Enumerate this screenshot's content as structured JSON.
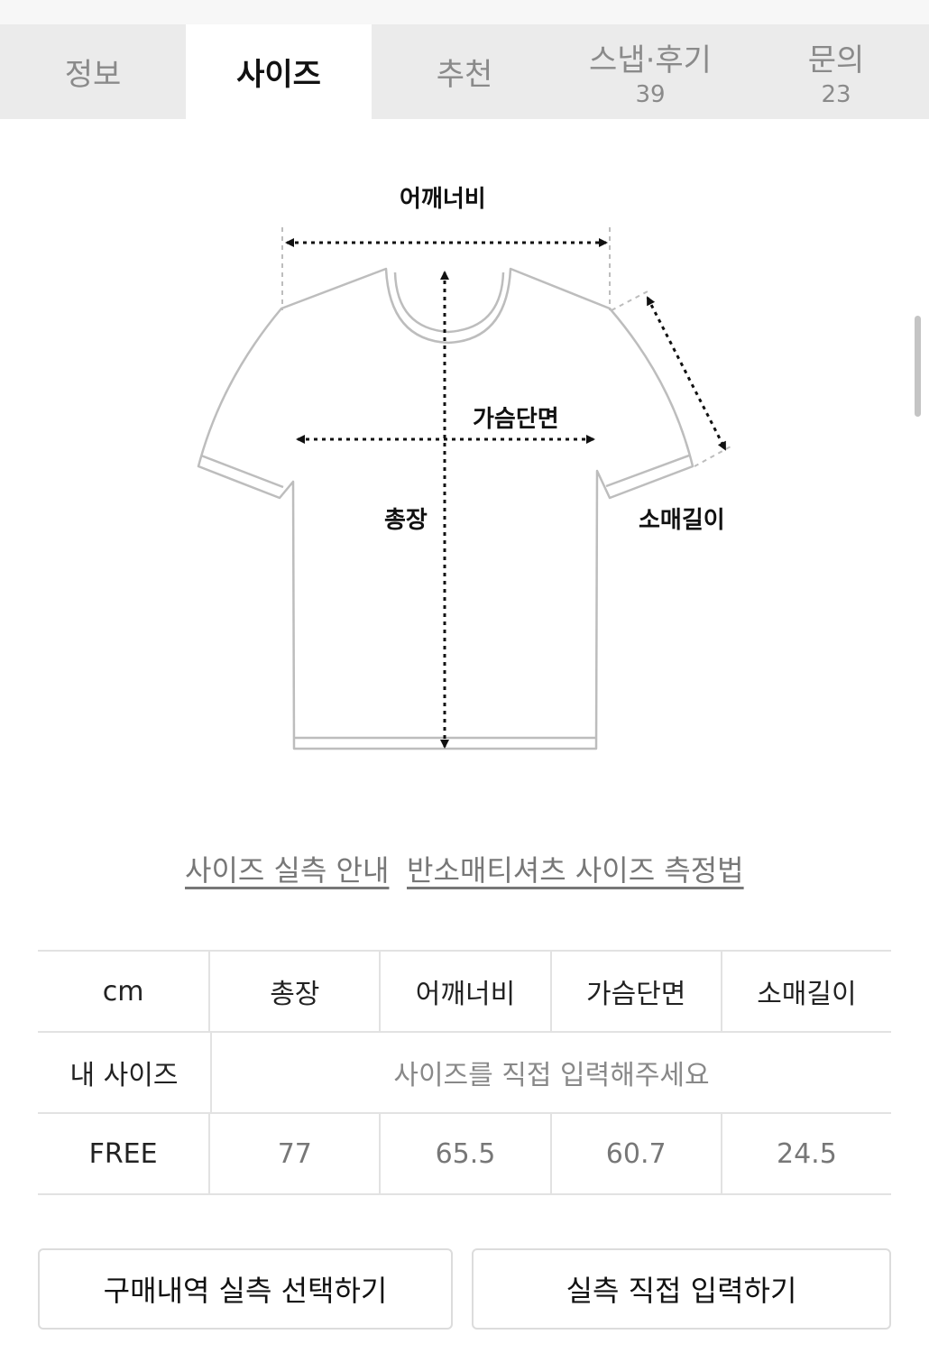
{
  "tabs": [
    {
      "label": "정보",
      "count": ""
    },
    {
      "label": "사이즈",
      "count": ""
    },
    {
      "label": "추천",
      "count": ""
    },
    {
      "label": "스냅·후기",
      "count": "39"
    },
    {
      "label": "문의",
      "count": "23"
    }
  ],
  "diagram": {
    "shoulder": "어깨너비",
    "chest": "가슴단면",
    "total_length": "총장",
    "sleeve": "소매길이"
  },
  "links": {
    "guide": "사이즈 실측 안내",
    "method": "반소매티셔츠 사이즈 측정법"
  },
  "table": {
    "header": [
      "cm",
      "총장",
      "어깨너비",
      "가슴단면",
      "소매길이"
    ],
    "my_size": {
      "label": "내 사이즈",
      "placeholder": "사이즈를 직접 입력해주세요"
    },
    "rows": [
      {
        "size": "FREE",
        "values": [
          "77",
          "65.5",
          "60.7",
          "24.5"
        ]
      }
    ]
  },
  "buttons": {
    "purchase": "구매내역 실측 선택하기",
    "direct": "실측 직접 입력하기"
  }
}
